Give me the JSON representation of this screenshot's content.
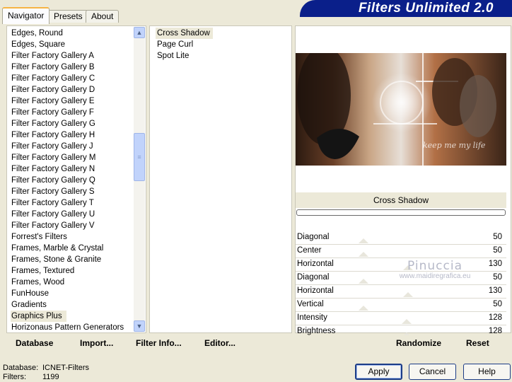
{
  "tabs": [
    {
      "label": "Navigator",
      "active": true
    },
    {
      "label": "Presets",
      "active": false
    },
    {
      "label": "About",
      "active": false
    }
  ],
  "banner": {
    "title": "Filters Unlimited 2.0"
  },
  "categories": {
    "items": [
      "Edges, Round",
      "Edges, Square",
      "Filter Factory Gallery A",
      "Filter Factory Gallery B",
      "Filter Factory Gallery C",
      "Filter Factory Gallery D",
      "Filter Factory Gallery E",
      "Filter Factory Gallery F",
      "Filter Factory Gallery G",
      "Filter Factory Gallery H",
      "Filter Factory Gallery J",
      "Filter Factory Gallery M",
      "Filter Factory Gallery N",
      "Filter Factory Gallery Q",
      "Filter Factory Gallery S",
      "Filter Factory Gallery T",
      "Filter Factory Gallery U",
      "Filter Factory Gallery V",
      "Forrest's Filters",
      "Frames, Marble & Crystal",
      "Frames, Stone & Granite",
      "Frames, Textured",
      "Frames, Wood",
      "FunHouse",
      "Gradients",
      "Graphics Plus",
      "Horizonaus Pattern Generators"
    ],
    "selected": "Graphics Plus"
  },
  "filters": {
    "items": [
      "Cross Shadow",
      "Page Curl",
      "Spot Lite"
    ],
    "selected": "Cross Shadow"
  },
  "preview": {
    "filter_name": "Cross Shadow",
    "caption": "keep me my life"
  },
  "watermark": {
    "line1": "Pinuccia",
    "line2": "www.maidiregrafica.eu"
  },
  "params": [
    {
      "label": "Diagonal",
      "value": "50"
    },
    {
      "label": "Center",
      "value": "50"
    },
    {
      "label": "Horizontal",
      "value": "130"
    },
    {
      "label": "Diagonal",
      "value": "50"
    },
    {
      "label": "Horizontal",
      "value": "130"
    },
    {
      "label": "Vertical",
      "value": "50"
    },
    {
      "label": "Intensity",
      "value": "128"
    },
    {
      "label": "Brightness",
      "value": "128"
    }
  ],
  "toolbar_left": {
    "database": "Database",
    "import": "Import...",
    "filter_info": "Filter Info...",
    "editor": "Editor..."
  },
  "toolbar_right": {
    "randomize": "Randomize",
    "reset": "Reset"
  },
  "status": {
    "database_label": "Database:",
    "database_value": "ICNET-Filters",
    "filters_label": "Filters:",
    "filters_value": "1199"
  },
  "buttons": {
    "apply": "Apply",
    "cancel": "Cancel",
    "help": "Help"
  },
  "colors": {
    "face": "#ece9d8",
    "banner": "#0a1f8a",
    "accent_tab": "#f6b443",
    "button_border": "#1c3c86"
  }
}
